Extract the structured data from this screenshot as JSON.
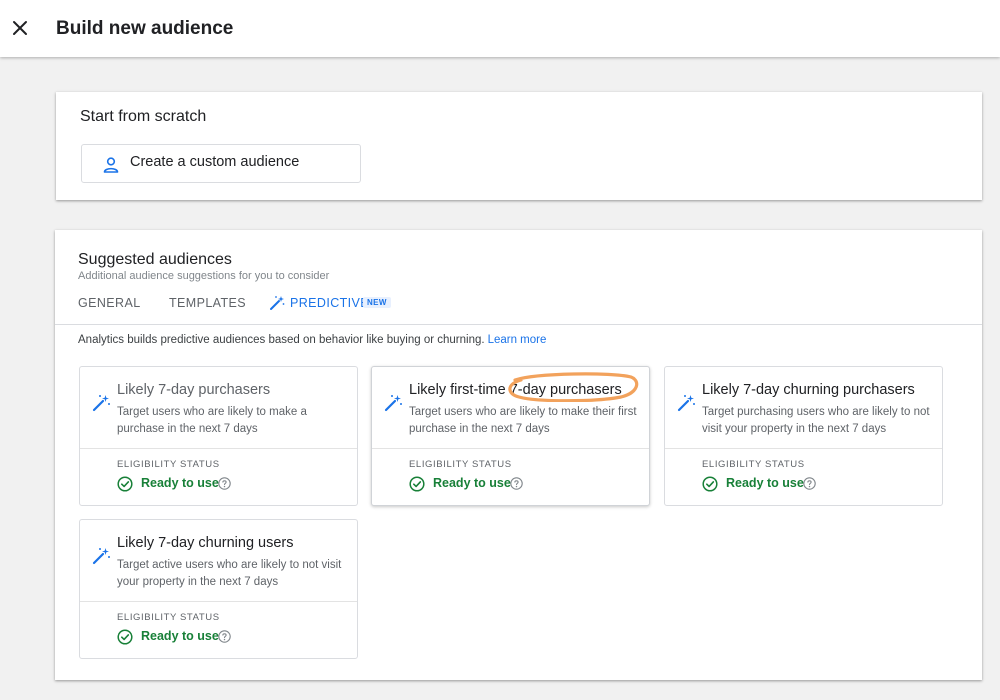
{
  "header": {
    "title": "Build new audience",
    "close_icon": "close-icon"
  },
  "scratch": {
    "title": "Start from scratch",
    "button_label": "Create a custom audience",
    "icon": "person-icon"
  },
  "suggested": {
    "title": "Suggested audiences",
    "subtitle": "Additional audience suggestions for you to consider",
    "tabs": [
      {
        "label": "GENERAL",
        "active": false
      },
      {
        "label": "TEMPLATES",
        "active": false
      },
      {
        "label": "PREDICTIVE",
        "active": true,
        "icon": "magic-wand-icon"
      }
    ],
    "new_badge": "NEW",
    "info_text": "Analytics builds predictive audiences based on behavior like buying or churning.",
    "learn_more": "Learn more",
    "cards": [
      {
        "title": "Likely 7-day purchasers",
        "description": "Target users who are likely to make a purchase in the next 7 days",
        "eligibility_label": "ELIGIBILITY STATUS",
        "status": "Ready to use"
      },
      {
        "title": "Likely first-time 7-day purchasers",
        "description": "Target users who are likely to make their first purchase in the next 7 days",
        "eligibility_label": "ELIGIBILITY STATUS",
        "status": "Ready to use"
      },
      {
        "title": "Likely 7-day churning purchasers",
        "description": "Target purchasing users who are likely to not visit your property in the next 7 days",
        "eligibility_label": "ELIGIBILITY STATUS",
        "status": "Ready to use"
      },
      {
        "title": "Likely 7-day churning users",
        "description": "Target active users who are likely to not visit your property in the next 7 days",
        "eligibility_label": "ELIGIBILITY STATUS",
        "status": "Ready to use"
      }
    ]
  },
  "colors": {
    "accent": "#1a73e8",
    "success": "#188038",
    "highlight": "#f2a25c"
  }
}
